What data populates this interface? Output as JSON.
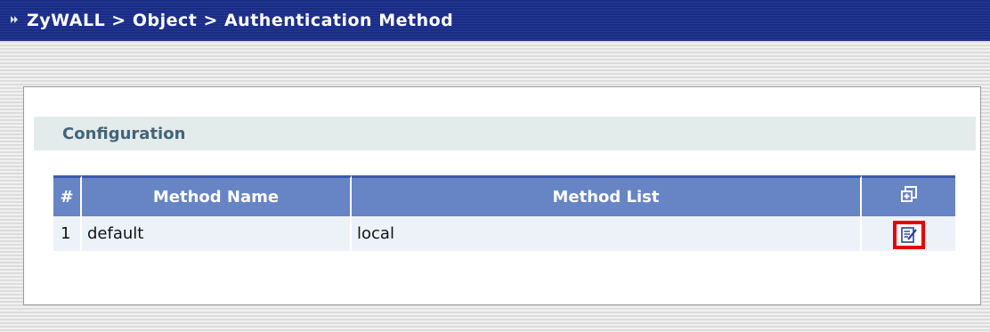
{
  "header": {
    "breadcrumb": "ZyWALL > Object > Authentication Method"
  },
  "section": {
    "title": "Configuration"
  },
  "table": {
    "columns": [
      "#",
      "Method Name",
      "Method List"
    ],
    "add_icon": "add-entry-icon",
    "rows": [
      {
        "num": "1",
        "name": "default",
        "list": "local",
        "edit_icon": "edit-icon"
      }
    ]
  },
  "colors": {
    "title_bar": "#1a2c82",
    "table_header": "#6784c4",
    "section_text": "#41657a",
    "highlight": "#e60000"
  }
}
